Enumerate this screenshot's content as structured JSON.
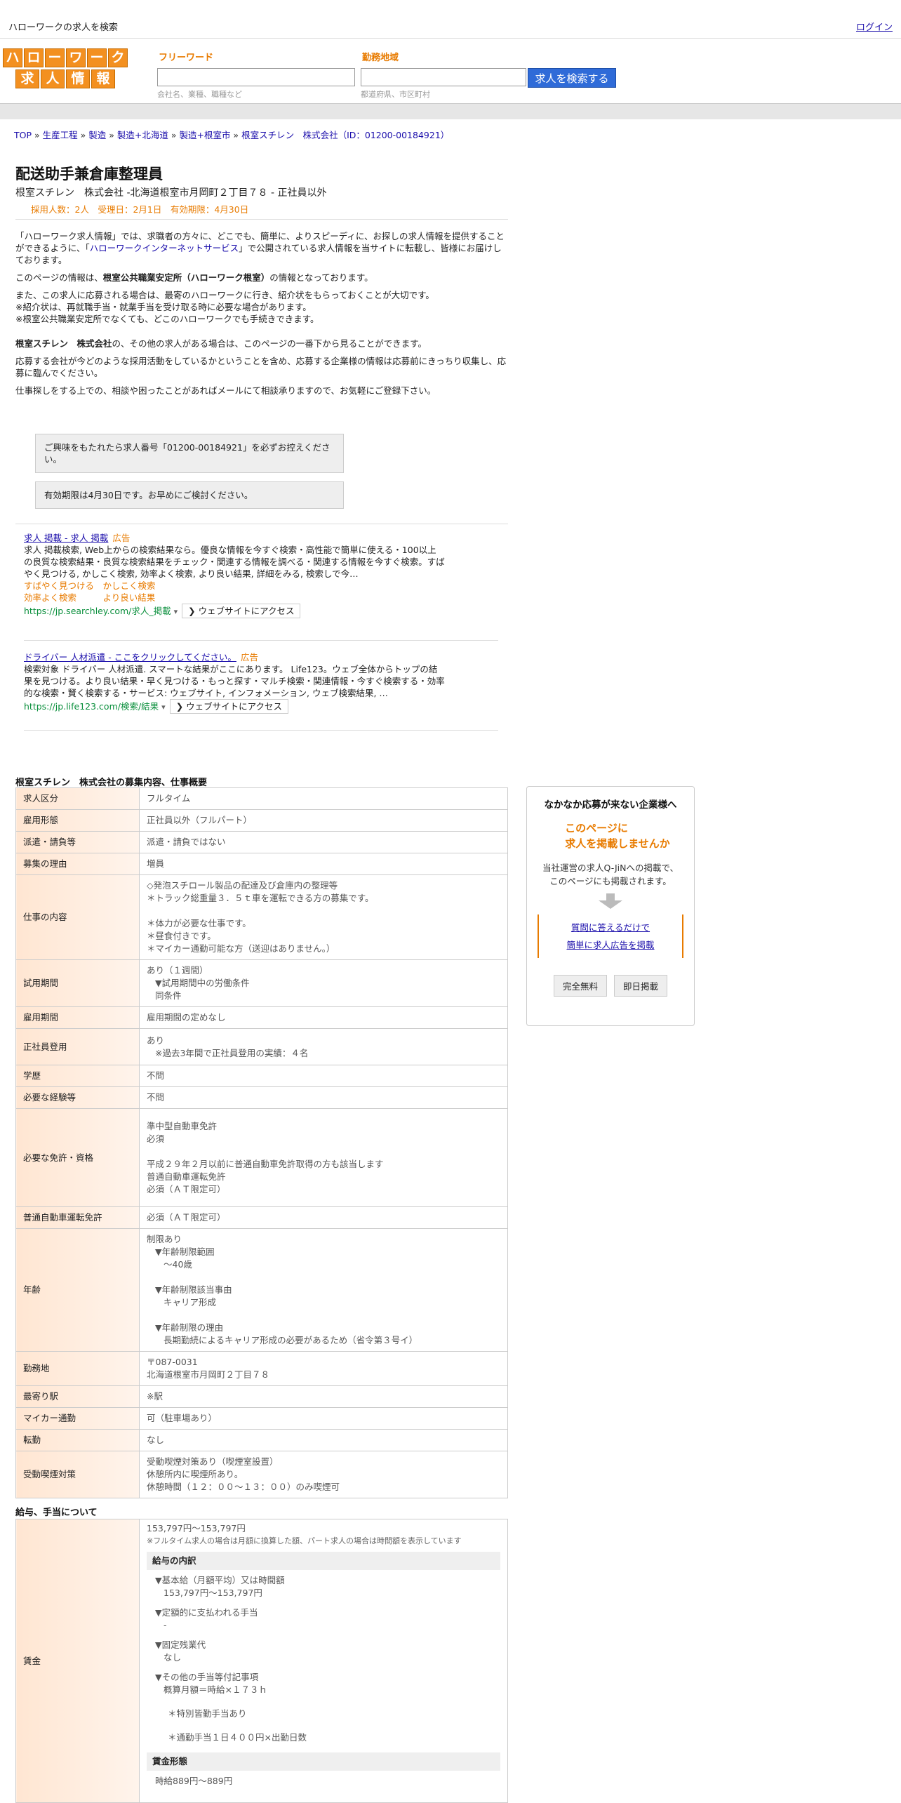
{
  "topbar": {
    "title": "ハローワークの求人を検索",
    "login": "ログイン"
  },
  "logo": {
    "row1": [
      "ハ",
      "ロ",
      "ー",
      "ワ",
      "ー",
      "ク"
    ],
    "row2": [
      "求",
      "人",
      "情",
      "報"
    ]
  },
  "search": {
    "keyword_label": "フリーワード",
    "keyword_hint": "会社名、業種、職種など",
    "area_label": "勤務地域",
    "area_hint": "都道府県、市区町村",
    "button": "求人を検索する"
  },
  "breadcrumb": [
    "TOP",
    "生産工程",
    "製造",
    "製造+北海道",
    "製造+根室市",
    "根室スチレン　株式会社（ID：01200-00184921）"
  ],
  "job": {
    "title": "配送助手兼倉庫整理員",
    "subtitle": "根室スチレン　株式会社 -北海道根室市月岡町２丁目７８ - 正社員以外",
    "meta": "採用人数：2人　受理日：2月1日　有効期限：4月30日"
  },
  "intro": {
    "p1a": "「ハローワーク求人情報」では、求職者の方々に、どこでも、簡単に、よりスピーディに、お探しの求人情報を提供することができるように、「",
    "p1link": "ハローワークインターネットサービス",
    "p1b": "」で公開されている求人情報を当サイトに転載し、皆様にお届けしております。",
    "p2a": "このページの情報は、",
    "p2b": "根室公共職業安定所（ハローワーク根室）",
    "p2c": "の情報となっております。",
    "p3l1": "また、この求人に応募される場合は、最寄のハローワークに行き、紹介状をもらっておくことが大切です。",
    "p3l2": "※紹介状は、再就職手当・就業手当を受け取る時に必要な場合があります。",
    "p3l3": "※根室公共職業安定所でなくても、どこのハローワークでも手続きできます。",
    "p4a": "根室スチレン　株式会社",
    "p4b": "の、その他の求人がある場合は、このページの一番下から見ることができます。",
    "p5": "応募する会社が今どのような採用活動をしているかということを含め、応募する企業様の情報は応募前にきっちり収集し、応募に臨んでください。",
    "p6": "仕事探しをする上での、相談や困ったことがあればメールにて相談承りますので、お気軽にご登録下さい。"
  },
  "notices": {
    "n1": "ご興味をもたれたら求人番号「01200-00184921」を必ずお控えください。",
    "n2": "有効期限は4月30日です。お早めにご検討ください。"
  },
  "ads": [
    {
      "title": "求人 掲載 - 求人 掲載",
      "badge": "広告",
      "desc": "求人 掲載検索, Web上からの検索結果なら。優良な情報を今すぐ検索・高性能で簡単に使える・100以上の良質な検索結果・良質な検索結果をチェック・関連する情報を調べる・関連する情報を今すぐ検索。すばやく見つける, かしこく検索, 効率よく検索, より良い結果, 詳細をみる, 検索しで今…",
      "links1": "すばやく見つける　かしこく検索",
      "links2": "効率よく検索　　　より良い結果",
      "url": "https://jp.searchley.com/求人_掲載",
      "visit": "ウェブサイトにアクセス"
    },
    {
      "title": "ドライバー 人材派遣 - ここをクリックしてください。",
      "badge": "広告",
      "desc": "検索対象 ドライバー 人材派遣. スマートな結果がここにあります。 Life123。ウェブ全体からトップの結果を見つける。より良い結果・早く見つける・もっと探す・マルチ検索・関連情報・今すぐ検索する・効率的な検索・賢く検索する・サービス: ウェブサイト, インフォメーション, ウェブ検索結果, …",
      "url": "https://jp.life123.com/検索/結果",
      "visit": "ウェブサイトにアクセス"
    }
  ],
  "sections": {
    "recruit": "根室スチレン　株式会社の募集内容、仕事概要",
    "salary": "給与、手当について"
  },
  "details": {
    "r1": {
      "k": "求人区分",
      "v": "フルタイム"
    },
    "r2": {
      "k": "雇用形態",
      "v": "正社員以外（フルパート）"
    },
    "r3": {
      "k": "派遣・請負等",
      "v": "派遣・請負ではない"
    },
    "r4": {
      "k": "募集の理由",
      "v": "増員"
    },
    "r5": {
      "k": "仕事の内容",
      "l1": "◇発泡スチロール製品の配達及び倉庫内の整理等",
      "l2": "＊トラック総重量３．５ｔ車を運転できる方の募集です。",
      "l3": "＊体力が必要な仕事です。",
      "l4": "＊昼食付きです。",
      "l5": "＊マイカー通勤可能な方（送迎はありません。）"
    },
    "r6": {
      "k": "試用期間",
      "l1": "あり（１週間）",
      "l2": "▼試用期間中の労働条件",
      "l3": "同条件"
    },
    "r7": {
      "k": "雇用期間",
      "v": "雇用期間の定めなし"
    },
    "r8": {
      "k": "正社員登用",
      "l1": "あり",
      "l2": "※過去3年間で正社員登用の実績：４名"
    },
    "r9": {
      "k": "学歴",
      "v": "不問"
    },
    "r10": {
      "k": "必要な経験等",
      "v": "不問"
    },
    "r11": {
      "k": "必要な免許・資格",
      "l1": "準中型自動車免許",
      "l2": "必須",
      "l3": "平成２９年２月以前に普通自動車免許取得の方も該当します",
      "l4": "普通自動車運転免許",
      "l5": "必須（ＡＴ限定可）"
    },
    "r12": {
      "k": "普通自動車運転免許",
      "v": "必須（ＡＴ限定可）"
    },
    "r13": {
      "k": "年齢",
      "l1": "制限あり",
      "l2": "▼年齢制限範囲",
      "l3": "〜40歳",
      "l4": "▼年齢制限該当事由",
      "l5": "キャリア形成",
      "l6": "▼年齢制限の理由",
      "l7": "長期勤続によるキャリア形成の必要があるため（省令第３号イ）"
    },
    "r14": {
      "k": "勤務地",
      "l1": "〒087-0031",
      "l2": "北海道根室市月岡町２丁目７８"
    },
    "r15": {
      "k": "最寄り駅",
      "v": "※駅"
    },
    "r16": {
      "k": "マイカー通勤",
      "v": "可（駐車場あり）"
    },
    "r17": {
      "k": "転勤",
      "v": "なし"
    },
    "r18": {
      "k": "受動喫煙対策",
      "l1": "受動喫煙対策あり（喫煙室設置）",
      "l2": "休憩所内に喫煙所あり。",
      "l3": "休憩時間（１２：００～１３：００）のみ喫煙可"
    }
  },
  "salary": {
    "k": "賃金",
    "range": "153,797円〜153,797円",
    "note": "※フルタイム求人の場合は月額に換算した額、パート求人の場合は時間額を表示しています",
    "breakdown_head": "給与の内訳",
    "b1": "▼基本給（月額平均）又は時間額",
    "b1v": "153,797円〜153,797円",
    "b2": "▼定額的に支払われる手当",
    "b2v": "-",
    "b3": "▼固定残業代",
    "b3v": "なし",
    "b4": "▼その他の手当等付記事項",
    "b4v": "概算月額＝時給×１７３ｈ",
    "b5": "＊特別皆勤手当あり",
    "b6": "＊通勤手当１日４００円×出勤日数",
    "form_head": "賃金形態",
    "form_v": "時給889円〜889円"
  },
  "side": {
    "title": "なかなか応募が来ない企業様へ",
    "catch1": "このページに",
    "catch2": "求人を掲載しませんか",
    "desc1": "当社運営の求人Q-JiNへの掲載で、",
    "desc2": "このページにも掲載されます。",
    "link1": "質問に答えるだけで",
    "link2": "簡単に求人広告を掲載",
    "btn1": "完全無料",
    "btn2": "即日掲載"
  }
}
